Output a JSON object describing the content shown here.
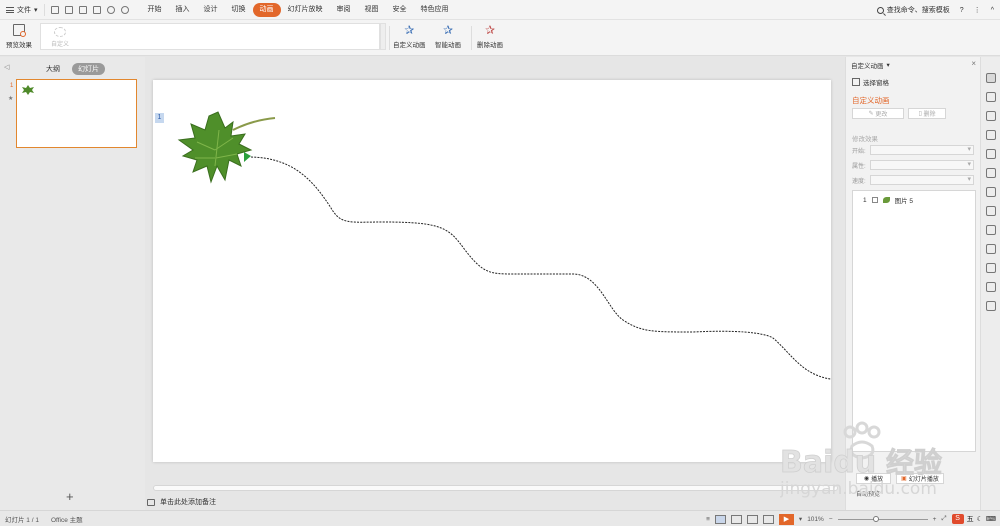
{
  "menubar": {
    "file_label": "文件",
    "tabs": [
      "开始",
      "插入",
      "设计",
      "切换",
      "动画",
      "幻灯片放映",
      "审阅",
      "视图",
      "安全",
      "特色应用"
    ],
    "active_tab": "动画",
    "search_text": "查找命令、搜索模板"
  },
  "ribbon": {
    "preview_label": "预览效果",
    "gallery_item": "自定义",
    "custom_anim_label": "自定义动画",
    "smart_anim_label": "智能动画",
    "delete_anim_label": "删除动画"
  },
  "leftpanel": {
    "tab_outline": "大纲",
    "tab_slides": "幻灯片",
    "slide_number": "1",
    "add_button": "+"
  },
  "canvas": {
    "slide_tag": "1",
    "notes_placeholder": "单击此处添加备注"
  },
  "rightpanel": {
    "title": "自定义动画",
    "select_pane": "选择窗格",
    "heading": "自定义动画",
    "change_btn": "更改",
    "delete_btn": "删除",
    "modify_label": "修改效果",
    "start_label": "开始:",
    "property_label": "属性:",
    "speed_label": "速度:",
    "list_item_num": "1",
    "list_item_label": "图片 5",
    "play_btn": "播放",
    "slideshow_btn": "幻灯片播放",
    "autopreview_label": "自动预览"
  },
  "status": {
    "slide_info": "幻灯片 1 / 1",
    "theme": "Office 主题",
    "zoom": "101%",
    "ime_label": "五"
  },
  "watermark": {
    "brand": "Baidu",
    "cn": "经验",
    "url": "jingyan.baidu.com"
  }
}
